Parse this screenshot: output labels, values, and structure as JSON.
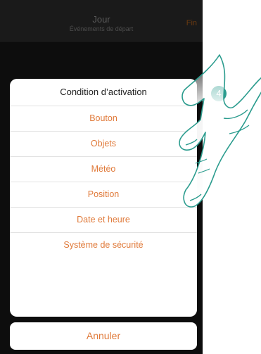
{
  "header": {
    "title": "Jour",
    "subtitle": "Événements de départ",
    "done_label": "Fin"
  },
  "sheet": {
    "title": "Condition d’activation",
    "options": [
      {
        "label": "Bouton"
      },
      {
        "label": "Objets"
      },
      {
        "label": "Météo"
      },
      {
        "label": "Position"
      },
      {
        "label": "Date et heure"
      },
      {
        "label": "Système de sécurité"
      }
    ]
  },
  "cancel_label": "Annuler",
  "step_badge": "4",
  "colors": {
    "accent": "#e07a3a",
    "background": "#0d0d0d",
    "badge": "#2b9c8e"
  }
}
